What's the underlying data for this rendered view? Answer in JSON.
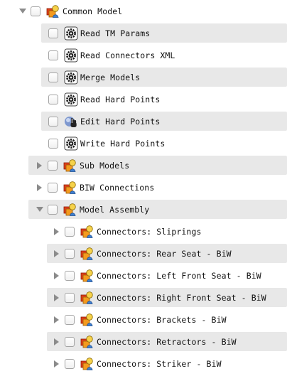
{
  "tree": {
    "root": {
      "label": "Common Model",
      "icon": "model-group-icon",
      "expanded": true
    },
    "tasks": [
      {
        "label": "Read TM Params",
        "icon": "gear-icon"
      },
      {
        "label": "Read Connectors XML",
        "icon": "gear-icon"
      },
      {
        "label": "Merge Models",
        "icon": "gear-icon"
      },
      {
        "label": "Read Hard Points",
        "icon": "gear-icon"
      },
      {
        "label": "Edit Hard Points",
        "icon": "interactive-hand-icon"
      },
      {
        "label": "Write Hard Points",
        "icon": "gear-icon"
      }
    ],
    "groups": [
      {
        "label": "Sub Models",
        "icon": "model-group-icon",
        "expanded": false
      },
      {
        "label": "BIW Connections",
        "icon": "model-group-icon",
        "expanded": false
      },
      {
        "label": "Model Assembly",
        "icon": "model-group-icon",
        "expanded": true
      }
    ],
    "assembly_children": [
      {
        "label": "Connectors: Sliprings",
        "icon": "model-group-icon"
      },
      {
        "label": "Connectors: Rear Seat - BiW",
        "icon": "model-group-icon"
      },
      {
        "label": "Connectors: Left Front Seat - BiW",
        "icon": "model-group-icon"
      },
      {
        "label": "Connectors: Right Front Seat - BiW",
        "icon": "model-group-icon"
      },
      {
        "label": "Connectors: Brackets - BiW",
        "icon": "model-group-icon"
      },
      {
        "label": "Connectors: Retractors - BiW",
        "icon": "model-group-icon"
      },
      {
        "label": "Connectors: Striker - BiW",
        "icon": "model-group-icon"
      }
    ]
  },
  "colors": {
    "row_shade": "#e8e8e8",
    "disclosure": "#8b8b8b",
    "checkbox_border": "#a3a3a3"
  }
}
